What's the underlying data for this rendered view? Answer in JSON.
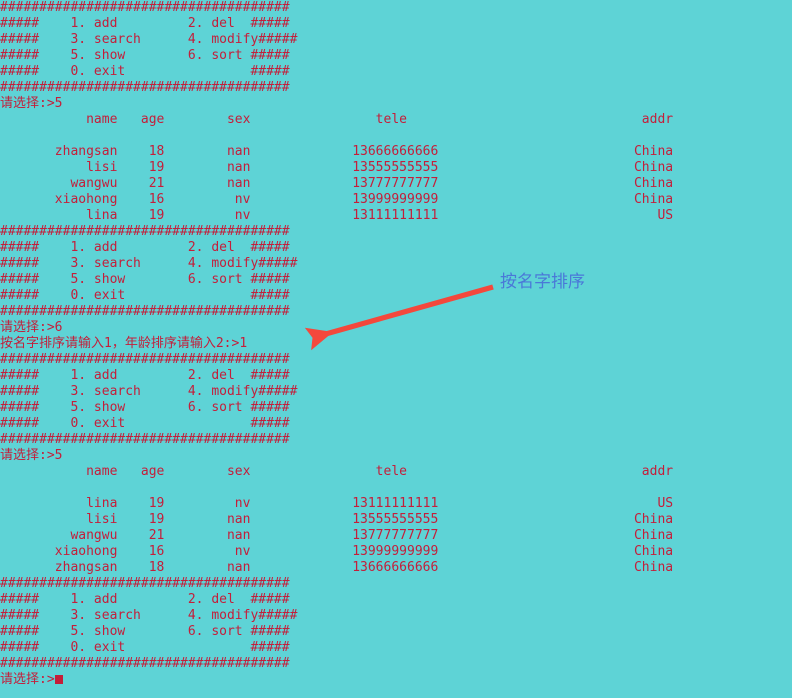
{
  "terminal": {
    "colors": {
      "background": "#5ed3d6",
      "text": "#c41e3a",
      "annotation": "#4a78d8",
      "arrow": "#f4483c"
    },
    "separator": "#####################################",
    "menu": {
      "border_left": "#####",
      "border_right": "#####",
      "rows": [
        {
          "left": "1. add",
          "right": "2. del"
        },
        {
          "left": "3. search",
          "right": "4. modify"
        },
        {
          "left": "5. show",
          "right": "6. sort"
        },
        {
          "left": "0. exit",
          "right": ""
        }
      ]
    },
    "prompt_label": "请选择:>",
    "prompts": {
      "first_choice": "5",
      "second_choice": "6",
      "third_choice": "5",
      "final_choice": ""
    },
    "sort_prompt": {
      "label": "按名字排序请输入1，年龄排序请输入2:>",
      "value": "1"
    },
    "table": {
      "headers": {
        "name": "name",
        "age": "age",
        "sex": "sex",
        "tele": "tele",
        "addr": "addr"
      },
      "unsorted_rows": [
        {
          "name": "zhangsan",
          "age": "18",
          "sex": "nan",
          "tele": "13666666666",
          "addr": "China"
        },
        {
          "name": "lisi",
          "age": "19",
          "sex": "nan",
          "tele": "13555555555",
          "addr": "China"
        },
        {
          "name": "wangwu",
          "age": "21",
          "sex": "nan",
          "tele": "13777777777",
          "addr": "China"
        },
        {
          "name": "xiaohong",
          "age": "16",
          "sex": "nv",
          "tele": "13999999999",
          "addr": "China"
        },
        {
          "name": "lina",
          "age": "19",
          "sex": "nv",
          "tele": "13111111111",
          "addr": "US"
        }
      ],
      "sorted_rows": [
        {
          "name": "lina",
          "age": "19",
          "sex": "nv",
          "tele": "13111111111",
          "addr": "US"
        },
        {
          "name": "lisi",
          "age": "19",
          "sex": "nan",
          "tele": "13555555555",
          "addr": "China"
        },
        {
          "name": "wangwu",
          "age": "21",
          "sex": "nan",
          "tele": "13777777777",
          "addr": "China"
        },
        {
          "name": "xiaohong",
          "age": "16",
          "sex": "nv",
          "tele": "13999999999",
          "addr": "China"
        },
        {
          "name": "zhangsan",
          "age": "18",
          "sex": "nan",
          "tele": "13666666666",
          "addr": "China"
        }
      ]
    }
  },
  "annotation": {
    "label": "按名字排序"
  }
}
